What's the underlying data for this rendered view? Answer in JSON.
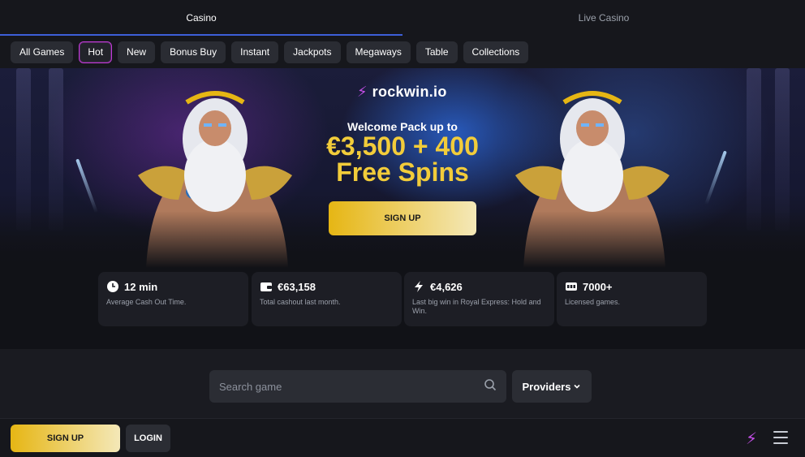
{
  "top_tabs": [
    {
      "label": "Casino",
      "active": true
    },
    {
      "label": "Live Casino",
      "active": false
    }
  ],
  "filters": [
    {
      "label": "All Games",
      "active": false
    },
    {
      "label": "Hot",
      "active": true
    },
    {
      "label": "New",
      "active": false
    },
    {
      "label": "Bonus Buy",
      "active": false
    },
    {
      "label": "Instant",
      "active": false
    },
    {
      "label": "Jackpots",
      "active": false
    },
    {
      "label": "Megaways",
      "active": false
    },
    {
      "label": "Table",
      "active": false
    },
    {
      "label": "Collections",
      "active": false
    }
  ],
  "hero": {
    "brand": "rockwin.io",
    "brand_icon": "lightning-bolt-icon",
    "welcome": "Welcome Pack up to",
    "amount": "€3,500 + 400",
    "spins": "Free Spins",
    "cta": "SIGN UP"
  },
  "stats": [
    {
      "icon": "clock-icon",
      "value": "12 min",
      "desc": "Average Cash Out Time."
    },
    {
      "icon": "wallet-icon",
      "value": "€63,158",
      "desc": "Total cashout last month."
    },
    {
      "icon": "lightning-bolt-icon",
      "value": "€4,626",
      "desc": "Last big win in Royal Express: Hold and Win."
    },
    {
      "icon": "slot-machine-icon",
      "value": "7000+",
      "desc": "Licensed games."
    }
  ],
  "search": {
    "placeholder": "Search game",
    "value": "",
    "providers_label": "Providers"
  },
  "bottom_bar": {
    "signup": "SIGN UP",
    "login": "LOGIN"
  },
  "colors": {
    "accent_gold": "#f2cc3a",
    "accent_purple": "#c34ee6",
    "tab_underline": "#3d5fd8",
    "background": "#111217"
  }
}
